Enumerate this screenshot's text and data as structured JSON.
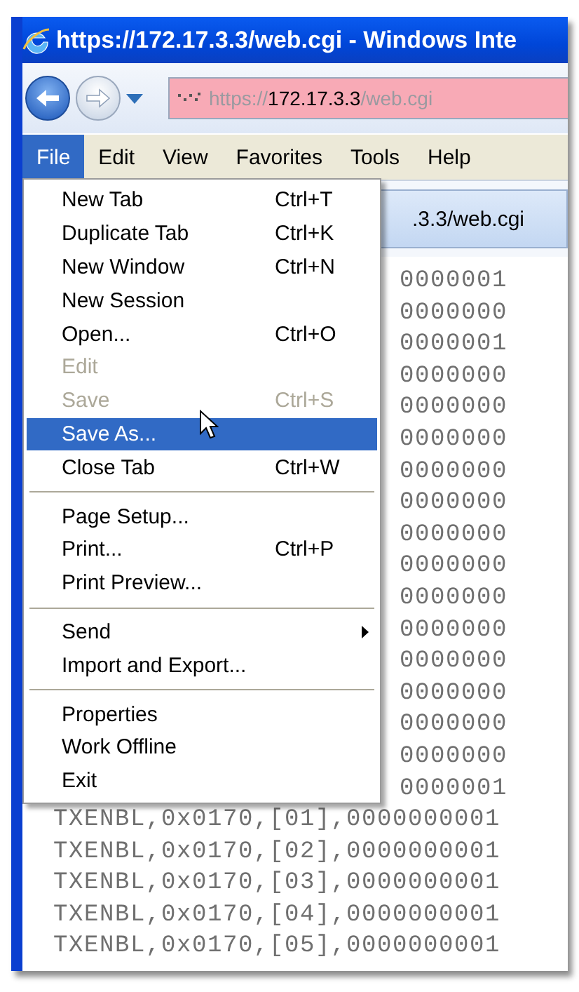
{
  "window": {
    "title": "https://172.17.3.3/web.cgi - Windows Inte"
  },
  "address_bar": {
    "scheme": "https://",
    "host": "172.17.3.3",
    "path": "/web.cgi"
  },
  "menu_bar": [
    {
      "label": "File",
      "selected": true
    },
    {
      "label": "Edit",
      "selected": false
    },
    {
      "label": "View",
      "selected": false
    },
    {
      "label": "Favorites",
      "selected": false
    },
    {
      "label": "Tools",
      "selected": false
    },
    {
      "label": "Help",
      "selected": false
    }
  ],
  "tab": {
    "title": ".3.3/web.cgi"
  },
  "content_lines": [
    {
      "kind": "partial",
      "text": "0000001"
    },
    {
      "kind": "partial",
      "text": "0000000"
    },
    {
      "kind": "partial",
      "text": "0000001"
    },
    {
      "kind": "partial",
      "text": "0000000"
    },
    {
      "kind": "partial",
      "text": "0000000"
    },
    {
      "kind": "partial",
      "text": "0000000"
    },
    {
      "kind": "partial",
      "text": "0000000"
    },
    {
      "kind": "partial",
      "text": "0000000"
    },
    {
      "kind": "partial",
      "text": "0000000"
    },
    {
      "kind": "partial",
      "text": "0000000"
    },
    {
      "kind": "partial",
      "text": "0000000"
    },
    {
      "kind": "partial",
      "text": "0000000"
    },
    {
      "kind": "partial",
      "text": "0000000"
    },
    {
      "kind": "partial",
      "text": "0000000"
    },
    {
      "kind": "partial",
      "text": "0000000"
    },
    {
      "kind": "partial",
      "text": "0000000"
    },
    {
      "kind": "partial",
      "text": "0000001"
    },
    {
      "kind": "full",
      "text": "TXENBL,0x0170,[01],0000000001"
    },
    {
      "kind": "full",
      "text": "TXENBL,0x0170,[02],0000000001"
    },
    {
      "kind": "full",
      "text": "TXENBL,0x0170,[03],0000000001"
    },
    {
      "kind": "full",
      "text": "TXENBL,0x0170,[04],0000000001"
    },
    {
      "kind": "full",
      "text": "TXENBL,0x0170,[05],0000000001"
    }
  ],
  "file_menu": [
    {
      "kind": "item",
      "label": "New Tab",
      "shortcut": "Ctrl+T",
      "disabled": false,
      "selected": false,
      "submenu": false
    },
    {
      "kind": "item",
      "label": "Duplicate Tab",
      "shortcut": "Ctrl+K",
      "disabled": false,
      "selected": false,
      "submenu": false
    },
    {
      "kind": "item",
      "label": "New Window",
      "shortcut": "Ctrl+N",
      "disabled": false,
      "selected": false,
      "submenu": false
    },
    {
      "kind": "item",
      "label": "New Session",
      "disabled": false,
      "selected": false,
      "submenu": false
    },
    {
      "kind": "item",
      "label": "Open...",
      "shortcut": "Ctrl+O",
      "disabled": false,
      "selected": false,
      "submenu": false
    },
    {
      "kind": "item",
      "label": "Edit",
      "disabled": true,
      "selected": false,
      "submenu": false
    },
    {
      "kind": "item",
      "label": "Save",
      "shortcut": "Ctrl+S",
      "disabled": true,
      "selected": false,
      "submenu": false
    },
    {
      "kind": "item",
      "label": "Save As...",
      "disabled": false,
      "selected": true,
      "submenu": false
    },
    {
      "kind": "item",
      "label": "Close Tab",
      "shortcut": "Ctrl+W",
      "disabled": false,
      "selected": false,
      "submenu": false
    },
    {
      "kind": "separator"
    },
    {
      "kind": "item",
      "label": "Page Setup...",
      "disabled": false,
      "selected": false,
      "submenu": false
    },
    {
      "kind": "item",
      "label": "Print...",
      "shortcut": "Ctrl+P",
      "disabled": false,
      "selected": false,
      "submenu": false
    },
    {
      "kind": "item",
      "label": "Print Preview...",
      "disabled": false,
      "selected": false,
      "submenu": false
    },
    {
      "kind": "separator"
    },
    {
      "kind": "item",
      "label": "Send",
      "disabled": false,
      "selected": false,
      "submenu": true
    },
    {
      "kind": "item",
      "label": "Import and Export...",
      "disabled": false,
      "selected": false,
      "submenu": false
    },
    {
      "kind": "separator"
    },
    {
      "kind": "item",
      "label": "Properties",
      "disabled": false,
      "selected": false,
      "submenu": false
    },
    {
      "kind": "item",
      "label": "Work Offline",
      "disabled": false,
      "selected": false,
      "submenu": false
    },
    {
      "kind": "item",
      "label": "Exit",
      "disabled": false,
      "selected": false,
      "submenu": false
    }
  ]
}
